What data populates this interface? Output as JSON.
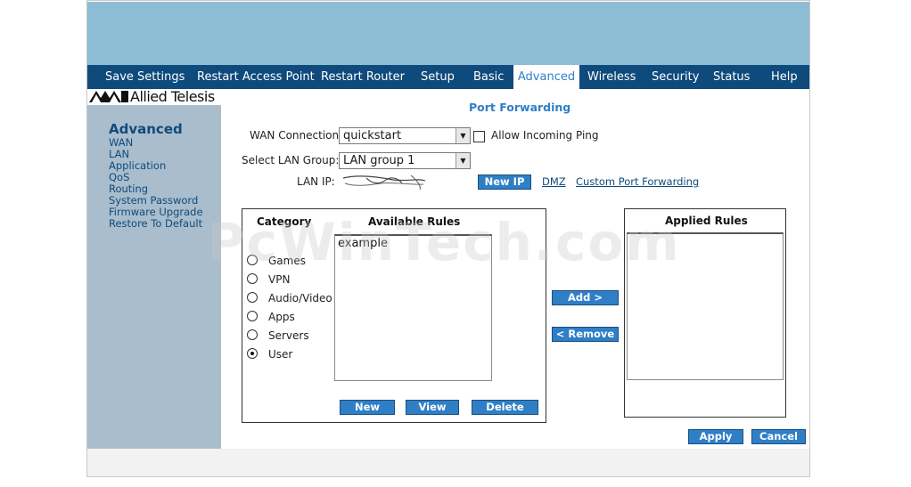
{
  "topnav": {
    "items": [
      {
        "label": "Save Settings"
      },
      {
        "label": "Restart Access Point"
      },
      {
        "label": "Restart Router"
      },
      {
        "label": "Setup"
      },
      {
        "label": "Basic"
      },
      {
        "label": "Advanced"
      },
      {
        "label": "Wireless"
      },
      {
        "label": "Security"
      },
      {
        "label": "Status"
      },
      {
        "label": "Help"
      }
    ],
    "active": "Advanced"
  },
  "logo": {
    "text": "Allied Telesis"
  },
  "sidebar": {
    "title": "Advanced",
    "links": [
      {
        "label": "WAN"
      },
      {
        "label": "LAN"
      },
      {
        "label": "Application"
      },
      {
        "label": "QoS"
      },
      {
        "label": "Routing"
      },
      {
        "label": "System Password"
      },
      {
        "label": "Firmware Upgrade"
      },
      {
        "label": "Restore To Default"
      }
    ]
  },
  "page": {
    "title": "Port Forwarding"
  },
  "form": {
    "wan_label": "WAN Connection:",
    "wan_value": "quickstart",
    "ping_label": "Allow Incoming Ping",
    "lan_group_label": "Select LAN Group:",
    "lan_group_value": "LAN group 1",
    "lan_ip_label": "LAN IP:",
    "new_ip_button": "New IP",
    "dmz_link": "DMZ",
    "custom_link": "Custom Port Forwarding"
  },
  "category": {
    "header": "Category",
    "options": [
      {
        "label": "Games",
        "checked": false
      },
      {
        "label": "VPN",
        "checked": false
      },
      {
        "label": "Audio/Video",
        "checked": false
      },
      {
        "label": "Apps",
        "checked": false
      },
      {
        "label": "Servers",
        "checked": false
      },
      {
        "label": "User",
        "checked": true
      }
    ]
  },
  "available": {
    "header": "Available Rules",
    "items": [
      "example"
    ],
    "new_button": "New",
    "view_button": "View",
    "delete_button": "Delete"
  },
  "transfer": {
    "add_button": "Add >",
    "remove_button": "< Remove"
  },
  "applied": {
    "header": "Applied Rules"
  },
  "actions": {
    "apply_button": "Apply",
    "cancel_button": "Cancel"
  },
  "watermark": "PcWinTech.com",
  "colors": {
    "nav_bg": "#0f4a7d",
    "banner": "#8dbdd4",
    "sidebar": "#a9bdcc",
    "accent": "#2f7fc6"
  }
}
